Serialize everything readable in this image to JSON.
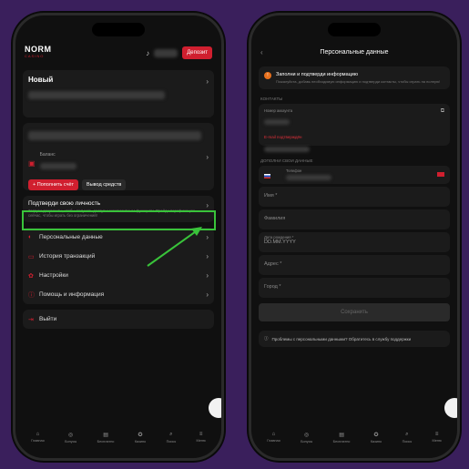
{
  "left": {
    "logo_main": "NORM",
    "logo_sub": "CASINO",
    "deposit_label": "Депозит",
    "username": "Новый",
    "balance_label": "Баланс",
    "topup_label": "+ Пополнить счёт",
    "withdraw_label": "Вывод средств",
    "verify_title": "Подтверди свою личность",
    "verify_text": "Загрузи документы, чтобы получить доступ к эксклюзивным функциям. Пройди верификацию сейчас, чтобы играть без ограничений!",
    "menu": [
      {
        "label": "Персональные данные",
        "icon": "shield-icon"
      },
      {
        "label": "История транзакций",
        "icon": "wallet-icon"
      },
      {
        "label": "Настройки",
        "icon": "gear-icon"
      },
      {
        "label": "Помощь и информация",
        "icon": "info-icon"
      },
      {
        "label": "Выйти",
        "icon": "logout-icon"
      }
    ]
  },
  "right": {
    "title": "Персональные данные",
    "notice_title": "Заполни и подтверди информацию",
    "notice_text": "Пожалуйста, добавь необходимую информацию и подтверди контакты, чтобы играть на полную!",
    "contacts_label": "КОНТАКТЫ",
    "account_number_label": "Номер аккаунта",
    "email_error": "E-mail подтверждён",
    "extra_label": "ДОПОЛНИ СВОИ ДАННЫЕ",
    "phone_label": "Телефон",
    "name_ph": "Имя *",
    "surname_ph": "Фамилия",
    "birth_label": "Дата рождения *",
    "birth_ph": "DD.MM.YYYY",
    "address_ph": "Адрес *",
    "city_ph": "Город *",
    "save_label": "Сохранить",
    "help_text": "Проблемы с персональными данными? Обратитесь в службу поддержки"
  },
  "nav": [
    {
      "label": "Главная"
    },
    {
      "label": "Бонусы"
    },
    {
      "label": "Бесплатно"
    },
    {
      "label": "Казино"
    },
    {
      "label": "Поиск"
    },
    {
      "label": "Меню"
    }
  ],
  "colors": {
    "accent": "#d01f2f",
    "highlight": "#39c33a",
    "background": "#3a1f5c"
  }
}
